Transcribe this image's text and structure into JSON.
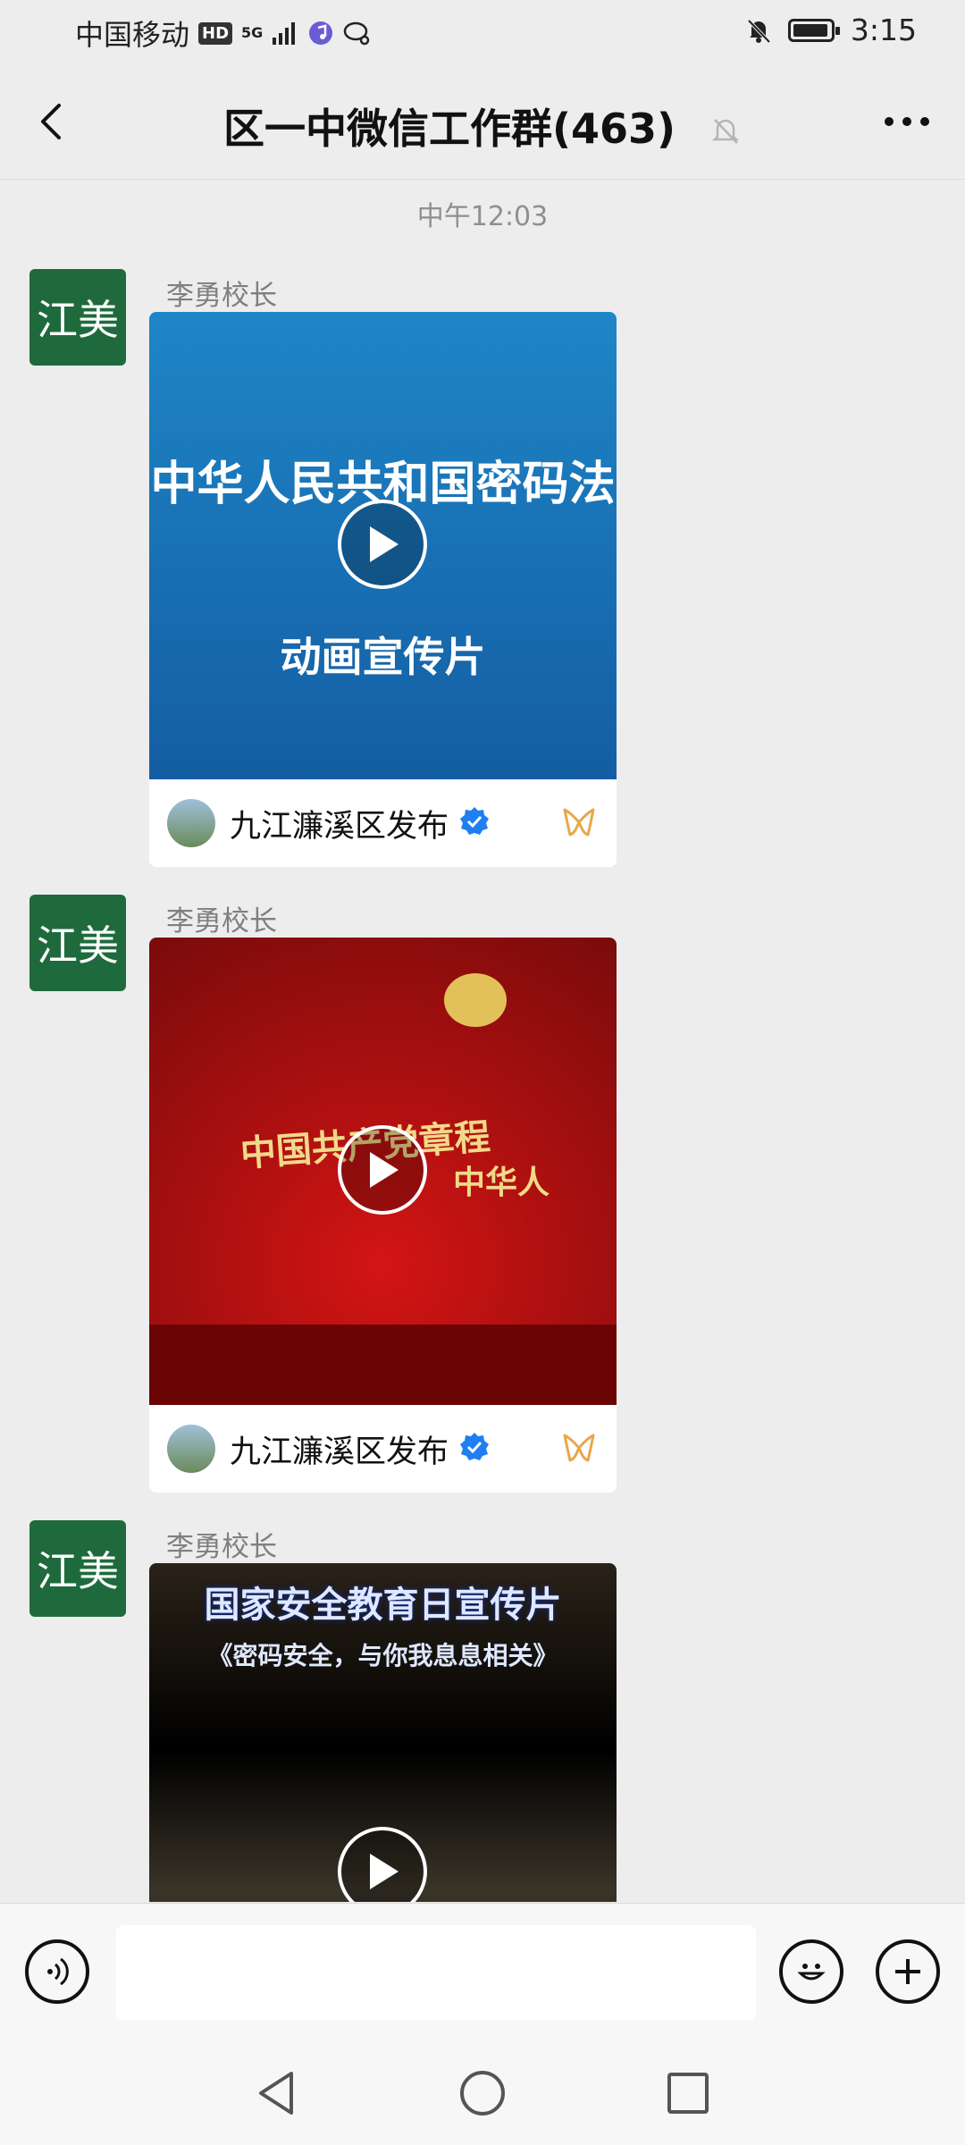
{
  "status_bar": {
    "carrier": "中国移动",
    "hd": "HD",
    "network": "5G",
    "time": "3:15"
  },
  "header": {
    "title": "区一中微信工作群(463)"
  },
  "chat": {
    "timestamp": "中午12:03",
    "messages": [
      {
        "sender": "李勇校长",
        "avatar_text": "江美",
        "video_line1": "中华人民共和国密码法",
        "video_line2": "动画宣传片",
        "source": "九江濂溪区发布"
      },
      {
        "sender": "李勇校长",
        "avatar_text": "江美",
        "video_line1": "中国共产党章程",
        "video_line2": "中华人",
        "source": "九江濂溪区发布"
      },
      {
        "sender": "李勇校长",
        "avatar_text": "江美",
        "video_line1": "国家安全教育日宣传片",
        "video_line2": "《密码安全，与你我息息相关》",
        "source": ""
      }
    ]
  },
  "colors": {
    "wechat_bg": "#ededed",
    "verified_blue": "#1d7ff2",
    "channel_gold": "#e8a74b"
  }
}
